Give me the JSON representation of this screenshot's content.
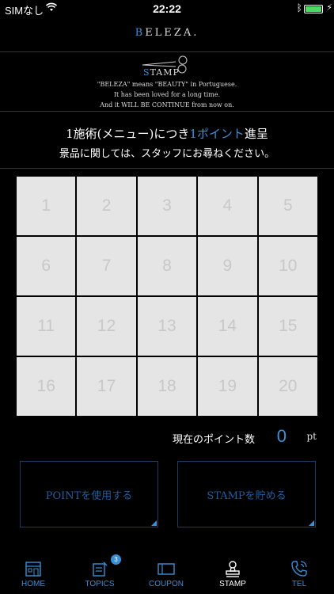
{
  "status": {
    "carrier": "SIMなし",
    "time": "22:22"
  },
  "brand": {
    "first": "B",
    "rest": "ELEZA."
  },
  "header": {
    "title_first": "S",
    "title_rest": "TAMP",
    "lines": [
      "\"BELEZA\" means \"BEAUTY\" in Portuguese.",
      "It has been loved for a long time.",
      "And it WILL BE CONTINUE from now on."
    ]
  },
  "promo": {
    "line1_pre": "1施術(メニュー)につき",
    "line1_accent": "1ポイント",
    "line1_post": "進呈",
    "line2": "景品に関しては、スタッフにお尋ねください。"
  },
  "stamp_cells": [
    "1",
    "2",
    "3",
    "4",
    "5",
    "6",
    "7",
    "8",
    "9",
    "10",
    "11",
    "12",
    "13",
    "14",
    "15",
    "16",
    "17",
    "18",
    "19",
    "20"
  ],
  "points": {
    "label": "現在のポイント数",
    "value": "0",
    "unit": "pt"
  },
  "buttons": {
    "use": "POINTを使用する",
    "save": "STAMPを貯める"
  },
  "tabs": [
    {
      "label": "HOME",
      "icon": "home-icon"
    },
    {
      "label": "TOPICS",
      "icon": "topics-icon",
      "badge": "3"
    },
    {
      "label": "COUPON",
      "icon": "coupon-icon"
    },
    {
      "label": "STAMP",
      "icon": "stamp-icon",
      "active": true
    },
    {
      "label": "TEL",
      "icon": "phone-icon"
    }
  ],
  "colors": {
    "accent": "#3b8fd6",
    "cell": "#e5e5e5",
    "background": "#000000"
  }
}
